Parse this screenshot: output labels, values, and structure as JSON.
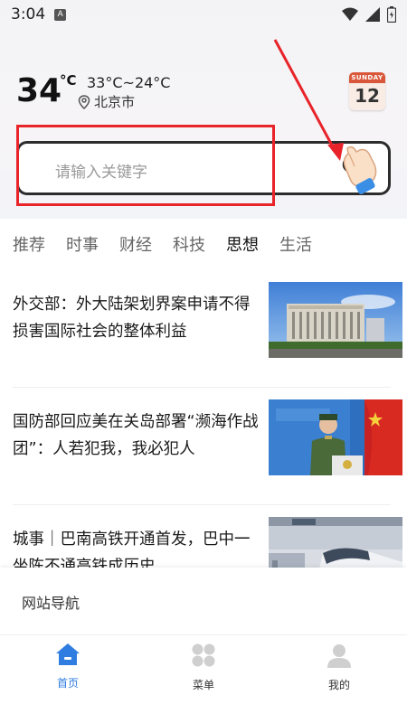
{
  "status_bar": {
    "time": "3:04",
    "notif_letter": "A"
  },
  "weather": {
    "temp": "34",
    "unit": "°C",
    "range": "33°C~24°C",
    "city": "北京市"
  },
  "calendar": {
    "weekday": "SUNDAY",
    "day": "12"
  },
  "search": {
    "placeholder": "请输入关键字"
  },
  "tabs": [
    {
      "label": "推荐"
    },
    {
      "label": "时事"
    },
    {
      "label": "财经"
    },
    {
      "label": "科技"
    },
    {
      "label": "思想"
    },
    {
      "label": "生活"
    }
  ],
  "news": [
    {
      "title": "外交部：外大陆架划界案申请不得损害国际社会的整体利益"
    },
    {
      "title": "国防部回应美在关岛部署“濒海作战团”：人若犯我，我必犯人"
    },
    {
      "title": "城事｜巴南高铁开通首发，巴中一坐陈不通高铁成历史"
    }
  ],
  "site_nav": {
    "label": "网站导航"
  },
  "bottom_nav": [
    {
      "label": "首页"
    },
    {
      "label": "菜单"
    },
    {
      "label": "我的"
    }
  ],
  "colors": {
    "accent": "#2f7de1",
    "annotation": "#e8232a"
  }
}
